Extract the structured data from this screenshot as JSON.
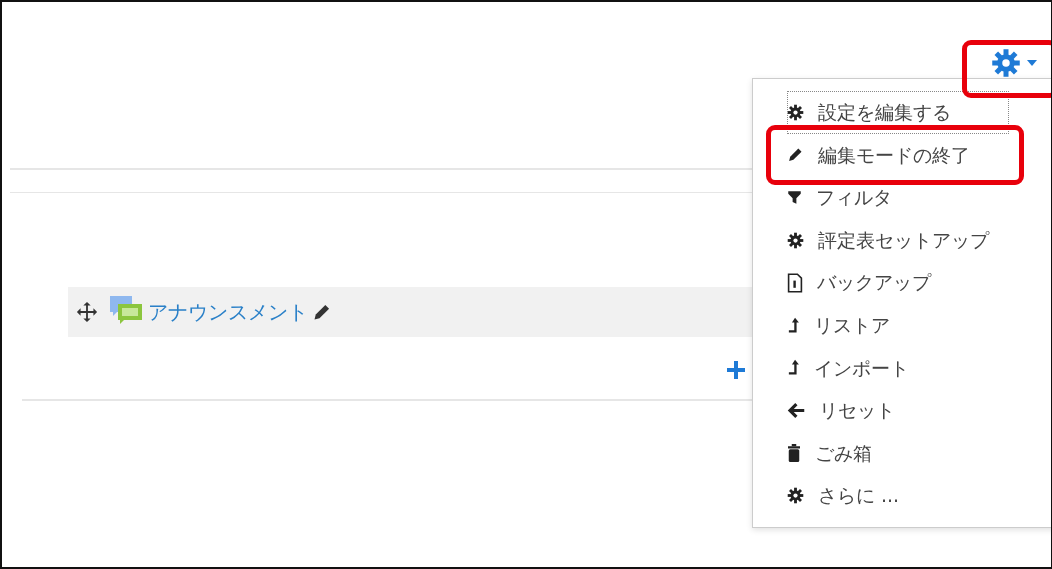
{
  "settings_button": {
    "expanded": true,
    "highlighted": true
  },
  "activity": {
    "title": "アナウンスメント"
  },
  "menu": {
    "items": [
      {
        "label": "設定を編集する",
        "focused": true,
        "highlighted": false
      },
      {
        "label": "編集モードの終了",
        "focused": false,
        "highlighted": true
      },
      {
        "label": "フィルタ",
        "focused": false,
        "highlighted": false
      },
      {
        "label": "評定表セットアップ",
        "focused": false,
        "highlighted": false
      },
      {
        "label": "バックアップ",
        "focused": false,
        "highlighted": false
      },
      {
        "label": "リストア",
        "focused": false,
        "highlighted": false
      },
      {
        "label": "インポート",
        "focused": false,
        "highlighted": false
      },
      {
        "label": "リセット",
        "focused": false,
        "highlighted": false
      },
      {
        "label": "ごみ箱",
        "focused": false,
        "highlighted": false
      },
      {
        "label": "さらに ...",
        "focused": false,
        "highlighted": false
      }
    ]
  }
}
